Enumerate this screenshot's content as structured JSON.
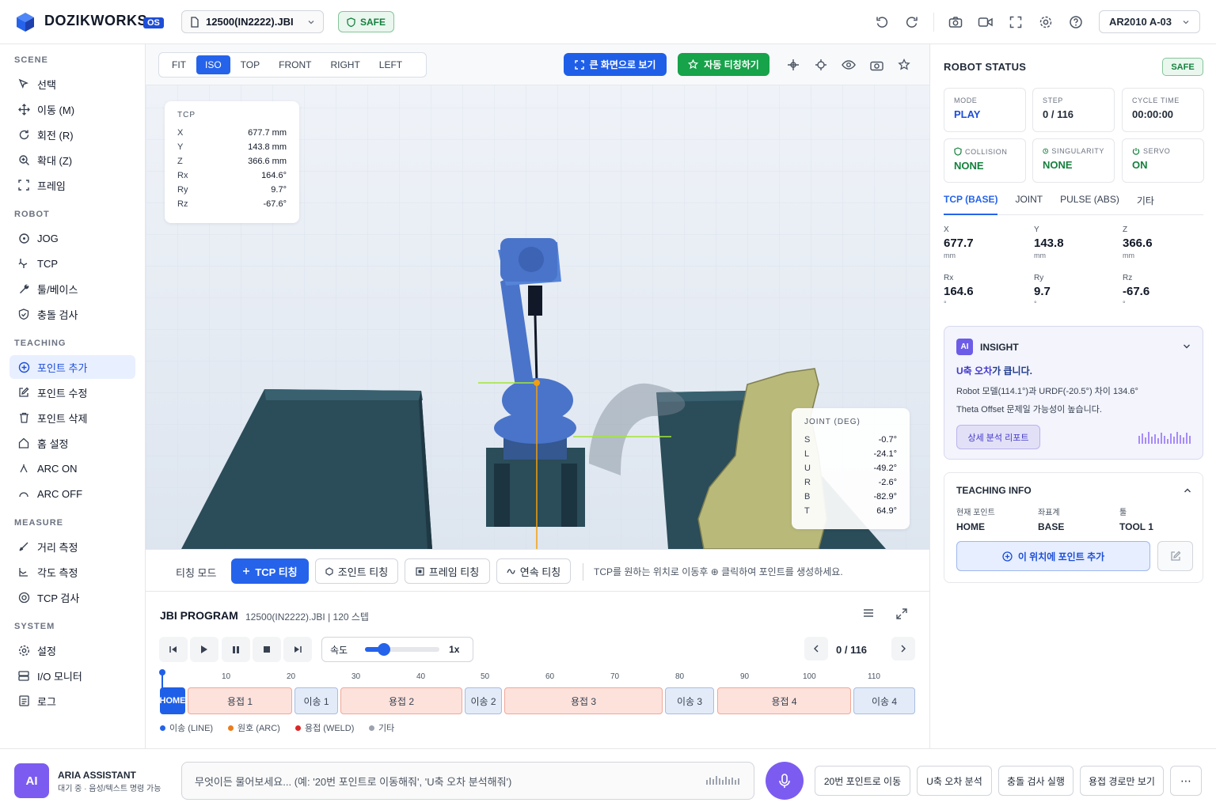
{
  "app": {
    "brand": "DOZIKWORKS",
    "os_badge": "OS",
    "file_name": "12500(IN2222).JBI",
    "safe_label": "SAFE",
    "robot_model": "AR2010 A-03",
    "icons": [
      "undo-icon",
      "redo-icon",
      "camera-icon",
      "video-icon",
      "fullscreen-icon",
      "gear-icon",
      "help-icon"
    ]
  },
  "sidebar": {
    "sections": [
      {
        "title": "SCENE",
        "items": [
          {
            "label": "선택",
            "icon": "cursor-icon"
          },
          {
            "label": "이동 (M)",
            "icon": "move-icon"
          },
          {
            "label": "회전 (R)",
            "icon": "rotate-icon"
          },
          {
            "label": "확대 (Z)",
            "icon": "zoom-icon"
          },
          {
            "label": "프레임",
            "icon": "frame-icon"
          }
        ]
      },
      {
        "title": "ROBOT",
        "items": [
          {
            "label": "JOG",
            "icon": "jog-icon"
          },
          {
            "label": "TCP",
            "icon": "tcp-icon"
          },
          {
            "label": "툴/베이스",
            "icon": "wrench-icon"
          },
          {
            "label": "충돌 검사",
            "icon": "shield-check-icon"
          }
        ]
      },
      {
        "title": "TEACHING",
        "items": [
          {
            "label": "포인트 추가",
            "icon": "plus-circle-icon",
            "active": true
          },
          {
            "label": "포인트 수정",
            "icon": "edit-icon"
          },
          {
            "label": "포인트 삭제",
            "icon": "trash-icon"
          },
          {
            "label": "홈 설정",
            "icon": "home-icon"
          },
          {
            "label": "ARC ON",
            "icon": "arc-on-icon"
          },
          {
            "label": "ARC OFF",
            "icon": "arc-off-icon"
          }
        ]
      },
      {
        "title": "MEASURE",
        "items": [
          {
            "label": "거리 측정",
            "icon": "ruler-icon"
          },
          {
            "label": "각도 측정",
            "icon": "angle-icon"
          },
          {
            "label": "TCP 검사",
            "icon": "target-icon"
          }
        ]
      },
      {
        "title": "SYSTEM",
        "items": [
          {
            "label": "설정",
            "icon": "gear-icon"
          },
          {
            "label": "I/O 모니터",
            "icon": "io-icon"
          },
          {
            "label": "로그",
            "icon": "log-icon"
          }
        ]
      }
    ]
  },
  "viewport": {
    "view_tabs": [
      "FIT",
      "ISO",
      "TOP",
      "FRONT",
      "RIGHT",
      "LEFT"
    ],
    "active_view": "ISO",
    "btn_full": "큰 화면으로 보기",
    "btn_auto": "자동 티칭하기",
    "tcp_panel": {
      "title": "TCP",
      "rows": [
        {
          "k": "X",
          "v": "677.7 mm"
        },
        {
          "k": "Y",
          "v": "143.8 mm"
        },
        {
          "k": "Z",
          "v": "366.6 mm"
        },
        {
          "k": "Rx",
          "v": "164.6°"
        },
        {
          "k": "Ry",
          "v": "9.7°"
        },
        {
          "k": "Rz",
          "v": "-67.6°"
        }
      ]
    },
    "joint_panel": {
      "title": "JOINT (DEG)",
      "rows": [
        {
          "k": "S",
          "v": "-0.7°"
        },
        {
          "k": "L",
          "v": "-24.1°"
        },
        {
          "k": "U",
          "v": "-49.2°"
        },
        {
          "k": "R",
          "v": "-2.6°"
        },
        {
          "k": "B",
          "v": "-82.9°"
        },
        {
          "k": "T",
          "v": "64.9°"
        }
      ]
    }
  },
  "teaching_bar": {
    "label": "티칭 모드",
    "buttons": [
      "TCP 티칭",
      "조인트 티칭",
      "프레임 티칭",
      "연속 티칭"
    ],
    "hint": "TCP를 원하는 위치로 이동후 ⊕ 클릭하여 포인트를 생성하세요."
  },
  "program": {
    "title": "JBI PROGRAM",
    "subtitle": "12500(IN2222).JBI | 120 스텝",
    "speed_label": "속도",
    "speed_value": "1x",
    "speed_fraction": 0.25,
    "step_count": "0 / 116",
    "ticks": [
      "10",
      "20",
      "30",
      "40",
      "50",
      "60",
      "70",
      "80",
      "90",
      "100",
      "110"
    ],
    "segments": [
      {
        "label": "HOME",
        "type": "home"
      },
      {
        "label": "용접 1",
        "type": "weld"
      },
      {
        "label": "이송 1",
        "type": "move"
      },
      {
        "label": "용접 2",
        "type": "weld"
      },
      {
        "label": "이송 2",
        "type": "move"
      },
      {
        "label": "용접 3",
        "type": "weld"
      },
      {
        "label": "이송 3",
        "type": "move"
      },
      {
        "label": "용접 4",
        "type": "weld"
      },
      {
        "label": "이송 4",
        "type": "move"
      }
    ],
    "legend": [
      {
        "label": "이송 (LINE)",
        "color": "#2563eb"
      },
      {
        "label": "원호 (ARC)",
        "color": "#ea7c1c"
      },
      {
        "label": "용접 (WELD)",
        "color": "#dc2626"
      },
      {
        "label": "기타",
        "color": "#9ca3af"
      }
    ]
  },
  "robot_status": {
    "title": "ROBOT STATUS",
    "safe": "SAFE",
    "cards": [
      {
        "label": "MODE",
        "value": "PLAY",
        "color": "#1d4ed8"
      },
      {
        "label": "STEP",
        "value": "0 / 116",
        "color": "#111827"
      },
      {
        "label": "CYCLE TIME",
        "value": "00:00:00",
        "color": "#111827"
      },
      {
        "label": "COLLISION",
        "value": "NONE",
        "color": "#15803d"
      },
      {
        "label": "SINGULARITY",
        "value": "NONE",
        "color": "#15803d"
      },
      {
        "label": "SERVO",
        "value": "ON",
        "color": "#15803d"
      }
    ],
    "tabs": [
      "TCP (BASE)",
      "JOINT",
      "PULSE (ABS)",
      "기타"
    ],
    "coords": [
      {
        "label": "X",
        "value": "677.7",
        "unit": "mm"
      },
      {
        "label": "Y",
        "value": "143.8",
        "unit": "mm"
      },
      {
        "label": "Z",
        "value": "366.6",
        "unit": "mm"
      },
      {
        "label": "Rx",
        "value": "164.6",
        "unit": "°"
      },
      {
        "label": "Ry",
        "value": "9.7",
        "unit": "°"
      },
      {
        "label": "Rz",
        "value": "-67.6",
        "unit": "°"
      }
    ]
  },
  "insight": {
    "chip": "AI",
    "title": "INSIGHT",
    "headline_em": "U축 오차",
    "headline_rest": "가 큽니다.",
    "line1": "Robot 모델(114.1°)과 URDF(-20.5°) 차이 134.6°",
    "line2": "Theta Offset 문제일 가능성이 높습니다.",
    "button": "상세 분석 리포트"
  },
  "teaching_info": {
    "title": "TEACHING INFO",
    "cols": [
      {
        "label": "현재 포인트",
        "value": "HOME"
      },
      {
        "label": "좌표계",
        "value": "BASE"
      },
      {
        "label": "툴",
        "value": "TOOL 1"
      }
    ],
    "add_button": "이 위치에 포인트 추가"
  },
  "assistant": {
    "avatar": "AI",
    "name": "ARIA ASSISTANT",
    "status": "대기 중 · 음성/텍스트 명령 가능",
    "placeholder": "무엇이든 물어보세요... (예: '20번 포인트로 이동해줘', 'U축 오차 분석해줘')",
    "quick": [
      "20번 포인트로 이동",
      "U축 오차 분석",
      "충돌 검사 실행",
      "용접 경로만 보기"
    ],
    "more": "⋯"
  }
}
